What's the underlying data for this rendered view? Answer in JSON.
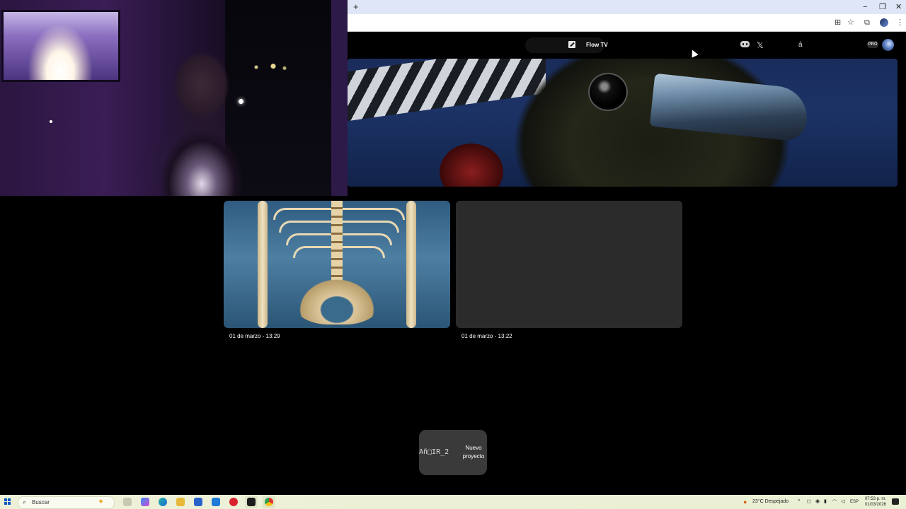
{
  "browser": {
    "new_tab_label": "+",
    "window_controls": {
      "minimize": "−",
      "restore": "❐",
      "close": "✕"
    }
  },
  "header": {
    "app_title": "Flow TV",
    "x_icon_label": "𝕏",
    "extra_icon_label": "á",
    "plan_badge": "PRO"
  },
  "projects": [
    {
      "date": "01 de marzo - 13:29",
      "thumbnail": "skeleton-anatomy"
    },
    {
      "date": "01 de marzo - 13:22",
      "thumbnail": "blank"
    }
  ],
  "new_project": {
    "glyph": "Añ□IR_2",
    "label": "Nuevo proyecto"
  },
  "taskbar": {
    "search_placeholder": "Buscar",
    "weather": "23°C  Despejado",
    "language": "ESP",
    "time": "07:53 p. m.",
    "date": "01/03/2026"
  },
  "colors": {
    "background": "#000000",
    "card_placeholder": "#2b2b2b",
    "new_project_bg": "#3a3a3a"
  }
}
